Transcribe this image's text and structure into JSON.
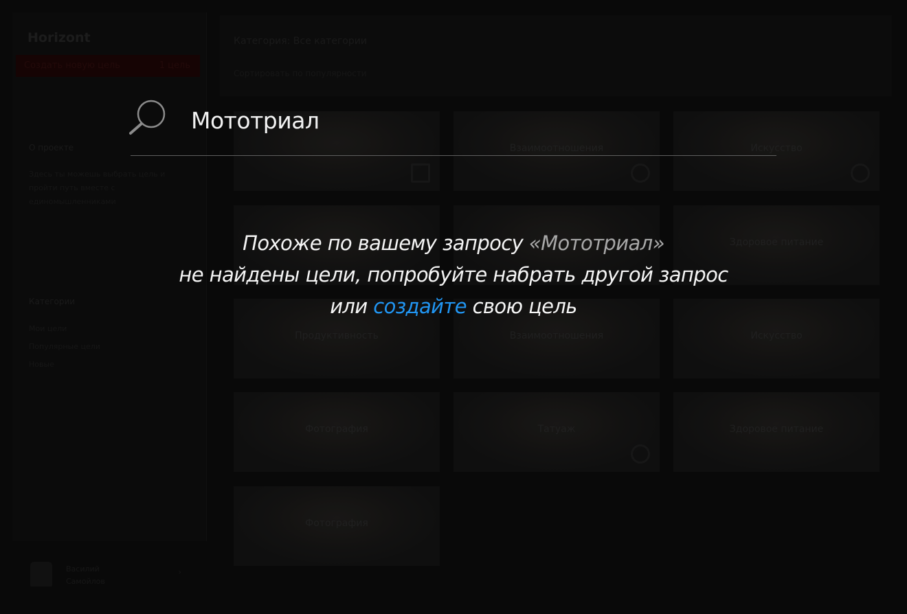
{
  "app": {
    "logo": "Horizont",
    "red_bar": {
      "label": "Создать новую цель",
      "count": "1 цель"
    }
  },
  "sidebar": {
    "heading_1": "О проекте",
    "text_1": "Здесь ты можешь выбрать цель и пройти путь вместе с единомышленниками",
    "heading_2": "Категории",
    "items": [
      "Мои цели",
      "Популярные цели",
      "Новые"
    ]
  },
  "user": {
    "first_name": "Василий",
    "last_name": "Самойлов"
  },
  "topbar": {
    "category_label": "Категория: Все категории",
    "sub_label": "Сортировать по популярности"
  },
  "tiles": [
    {
      "label": ""
    },
    {
      "label": "Взаимоотношения"
    },
    {
      "label": "Искусство"
    },
    {
      "label": ""
    },
    {
      "label": ""
    },
    {
      "label": "Здоровое питание"
    },
    {
      "label": "Продуктивность"
    },
    {
      "label": "Взаимоотношения"
    },
    {
      "label": "Искусство"
    },
    {
      "label": "Фотография"
    },
    {
      "label": "Татуаж"
    },
    {
      "label": "Здоровое питание"
    },
    {
      "label": "Фотография"
    }
  ],
  "search": {
    "value": "Мототриал",
    "icon": "search-icon"
  },
  "message": {
    "line1_prefix": "Похоже по вашему запросу ",
    "query_quoted": "«Мототриал»",
    "line2": "не найдены цели, попробуйте набрать другой запрос",
    "line3_prefix": "или ",
    "link_text": "создайте",
    "line3_suffix": " свою цель"
  },
  "colors": {
    "link": "#2196f3",
    "query": "#a8a8a8",
    "text": "#f5f5f5",
    "overlay_bg": "#0b0b0b"
  }
}
